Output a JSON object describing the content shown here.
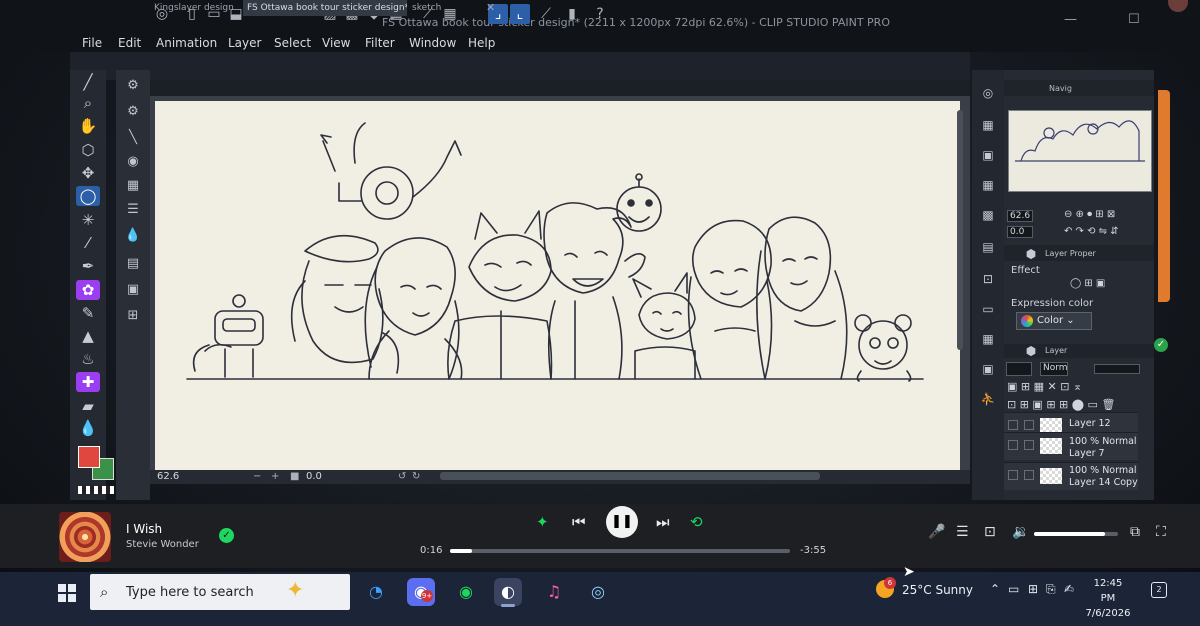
{
  "window": {
    "title": "FS Ottawa book tour sticker design* (2211 x 1200px 72dpi 62.6%)  - CLIP STUDIO PAINT PRO",
    "controls": [
      "—",
      "☐",
      "✕"
    ]
  },
  "menu": [
    "File",
    "Edit",
    "Animation",
    "Layer",
    "Select",
    "View",
    "Filter",
    "Window",
    "Help"
  ],
  "tabs": [
    {
      "label": "Kingslayer design",
      "active": false
    },
    {
      "label": "FS Ottawa book tour sticker design*",
      "active": true
    },
    {
      "label": "sketch",
      "active": false
    }
  ],
  "canvas": {
    "zoom": "62.6",
    "rotation": "0.0"
  },
  "panels": {
    "navigator_label": "Navig",
    "nav_zoom": "62.6",
    "nav_rotation": "0.0",
    "layer_property_label": "Layer Proper",
    "effect_label": "Effect",
    "expression_color_label": "Expression color",
    "expression_color_value": "Color",
    "layer_panel_label": "Layer",
    "blend_mode": "Norm"
  },
  "layers": [
    {
      "line1": "Layer 12",
      "line2": ""
    },
    {
      "line1": "100 % Normal",
      "line2": "Layer 7"
    },
    {
      "line1": "100 % Normal",
      "line2": "Layer 14 Copy"
    }
  ],
  "player": {
    "song": "I Wish",
    "artist": "Stevie Wonder",
    "elapsed": "0:16",
    "remaining": "-3:55",
    "progress_fraction": 0.064,
    "volume_fraction": 0.85
  },
  "taskbar": {
    "search_placeholder": "Type here to search",
    "weather": "25°C  Sunny",
    "weather_badge": "6",
    "time": "12:45 PM",
    "date": "7/6/2026",
    "notifications": "2",
    "app_badge": "9+"
  },
  "colors": {
    "accent": "#2c5fa8",
    "main_color": "#e0483f",
    "sub_color": "#3b9147",
    "spotify_green": "#1ed760"
  }
}
